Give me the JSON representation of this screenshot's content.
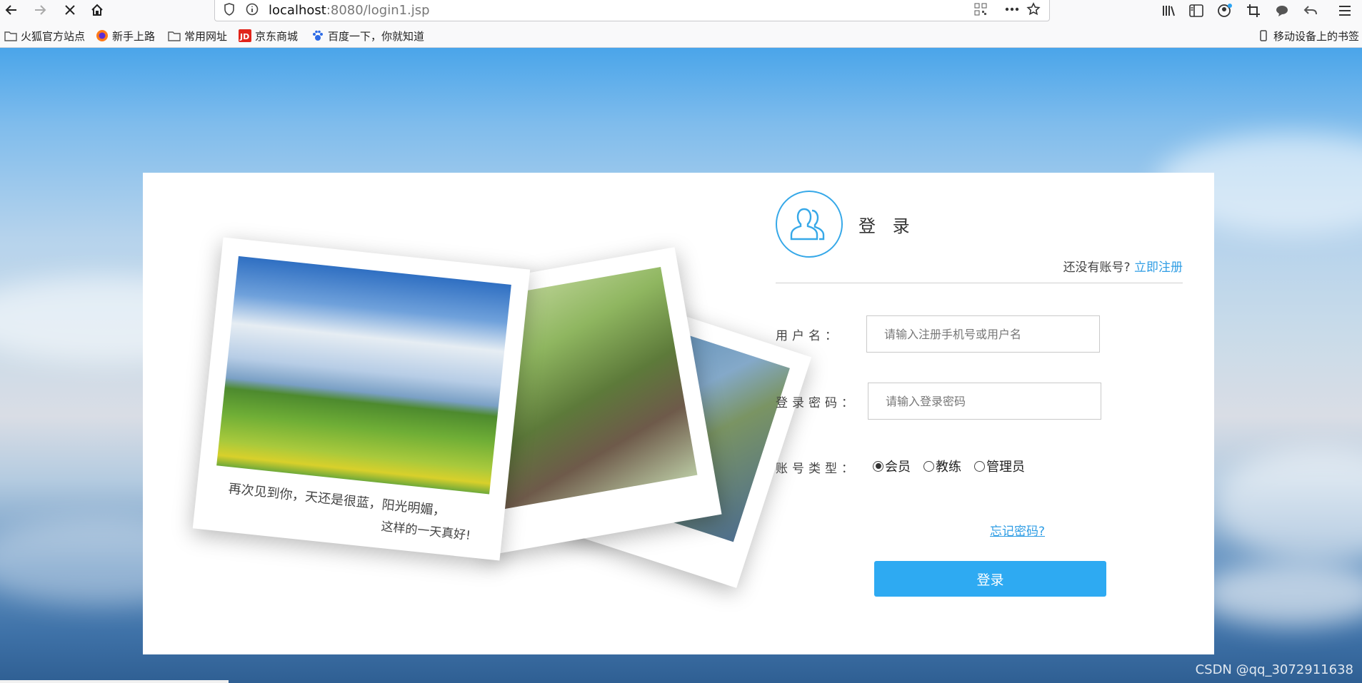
{
  "browser": {
    "url_host": "localhost",
    "url_rest": ":8080/login1.jsp",
    "bookmarks": [
      {
        "label": "火狐官方站点",
        "icon": "folder-icon"
      },
      {
        "label": "新手上路",
        "icon": "firefox-icon"
      },
      {
        "label": "常用网址",
        "icon": "folder-icon"
      },
      {
        "label": "京东商城",
        "icon": "jd-icon"
      },
      {
        "label": "百度一下，你就知道",
        "icon": "baidu-paw-icon"
      }
    ],
    "mobile_bookmarks": "移动设备上的书签"
  },
  "photos": {
    "caption_line1": "再次见到你，天还是很蓝，阳光明媚，",
    "caption_line2": "这样的一天真好!"
  },
  "form": {
    "title": "登 录",
    "no_account": "还没有账号?",
    "register_link": "立即注册",
    "username_label": "用户名：",
    "username_placeholder": "请输入注册手机号或用户名",
    "password_label": "登录密码：",
    "password_placeholder": "请输入登录密码",
    "type_label": "账号类型：",
    "types": [
      {
        "label": "会员",
        "checked": true
      },
      {
        "label": "教练",
        "checked": false
      },
      {
        "label": "管理员",
        "checked": false
      }
    ],
    "forgot": "忘记密码?",
    "submit": "登录"
  },
  "watermark": "CSDN @qq_3072911638",
  "colors": {
    "accent": "#2eaaf2",
    "link": "#2f9de4"
  }
}
